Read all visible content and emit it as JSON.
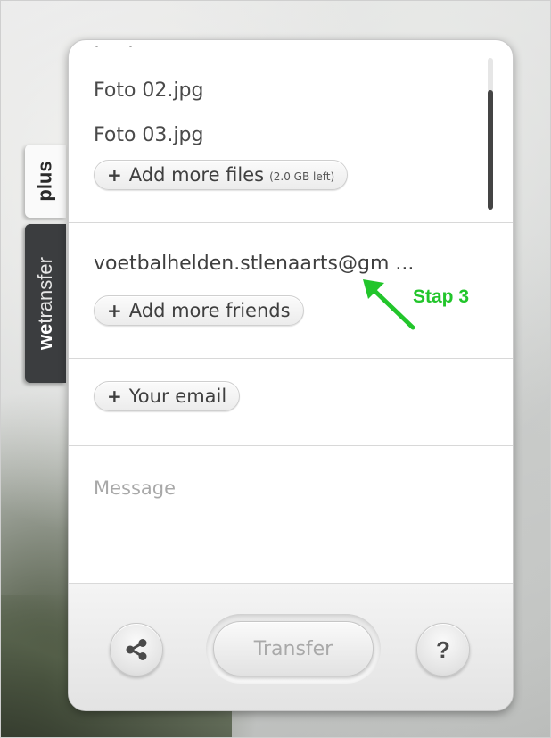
{
  "side_tabs": {
    "plus_label": "plus",
    "brand_prefix": "we",
    "brand_suffix": "transfer"
  },
  "files": {
    "items": [
      "Foto 02.jpg",
      "Foto 03.jpg"
    ],
    "add_label": "Add more files",
    "space_left": "(2.0 GB left)"
  },
  "friends": {
    "email": "voetbalhelden.stlenaarts@gm ...",
    "add_label": "Add more friends",
    "annotation": "Stap 3"
  },
  "your_email": {
    "label": "Your email"
  },
  "message": {
    "placeholder": "Message"
  },
  "footer": {
    "transfer_label": "Transfer",
    "help_label": "?"
  },
  "icons": {
    "plus": "plus-icon",
    "share": "share-icon",
    "arrow": "arrow-annotation-icon",
    "help": "help-icon"
  },
  "colors": {
    "annotation_green": "#22c52b",
    "side_tab_dark": "#3b3d3f",
    "transfer_disabled_text": "#a9a9a9"
  }
}
